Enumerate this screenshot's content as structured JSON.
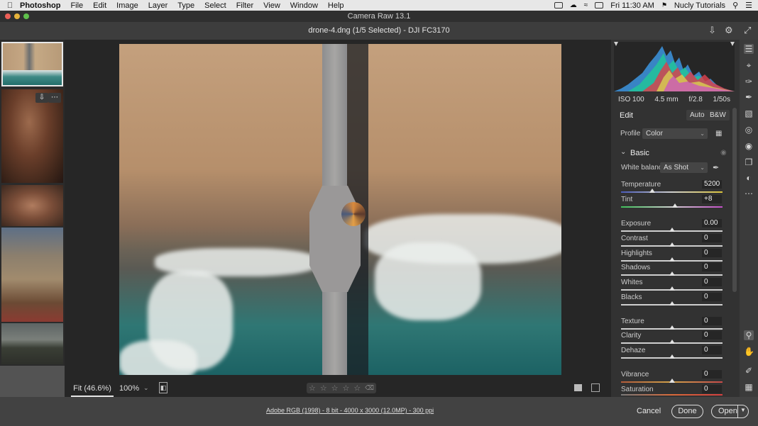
{
  "menubar": {
    "app_name": "Photoshop",
    "items": [
      "File",
      "Edit",
      "Image",
      "Layer",
      "Type",
      "Select",
      "Filter",
      "View",
      "Window",
      "Help"
    ],
    "clock": "Fri 11:30 AM",
    "user": "Nucly Tutorials"
  },
  "window": {
    "title": "Camera Raw 13.1",
    "file_header": "drone-4.dng (1/5 Selected)  -  DJI FC3170"
  },
  "canvas": {
    "fit_label": "Fit (46.6%)",
    "zoom_label": "100%",
    "rating_stars": 5
  },
  "exif": {
    "iso": "ISO 100",
    "focal": "4.5 mm",
    "aperture": "f/2.8",
    "shutter": "1/50s"
  },
  "edit": {
    "title": "Edit",
    "auto_label": "Auto",
    "bw_label": "B&W",
    "profile_label": "Profile",
    "profile_value": "Color",
    "basic_title": "Basic",
    "wb_label": "White balance",
    "wb_value": "As Shot",
    "sliders": [
      {
        "label": "Temperature",
        "value": "5200",
        "level": 0.31
      },
      {
        "label": "Tint",
        "value": "+8",
        "level": 0.53
      },
      {
        "label": "Exposure",
        "value": "0.00",
        "level": 0.5
      },
      {
        "label": "Contrast",
        "value": "0",
        "level": 0.5
      },
      {
        "label": "Highlights",
        "value": "0",
        "level": 0.5
      },
      {
        "label": "Shadows",
        "value": "0",
        "level": 0.5
      },
      {
        "label": "Whites",
        "value": "0",
        "level": 0.5
      },
      {
        "label": "Blacks",
        "value": "0",
        "level": 0.5
      },
      {
        "label": "Texture",
        "value": "0",
        "level": 0.5
      },
      {
        "label": "Clarity",
        "value": "0",
        "level": 0.5
      },
      {
        "label": "Dehaze",
        "value": "0",
        "level": 0.5
      },
      {
        "label": "Vibrance",
        "value": "0",
        "level": 0.5
      },
      {
        "label": "Saturation",
        "value": "0",
        "level": 0.5
      }
    ]
  },
  "status": {
    "file_info": "Adobe RGB (1998) - 8 bit - 4000 x 3000 (12.0MP) - 300 ppi",
    "cancel_label": "Cancel",
    "done_label": "Done",
    "open_label": "Open"
  },
  "colors": {
    "accent_white": "#e6e6e6",
    "panel_bg": "#323232"
  }
}
